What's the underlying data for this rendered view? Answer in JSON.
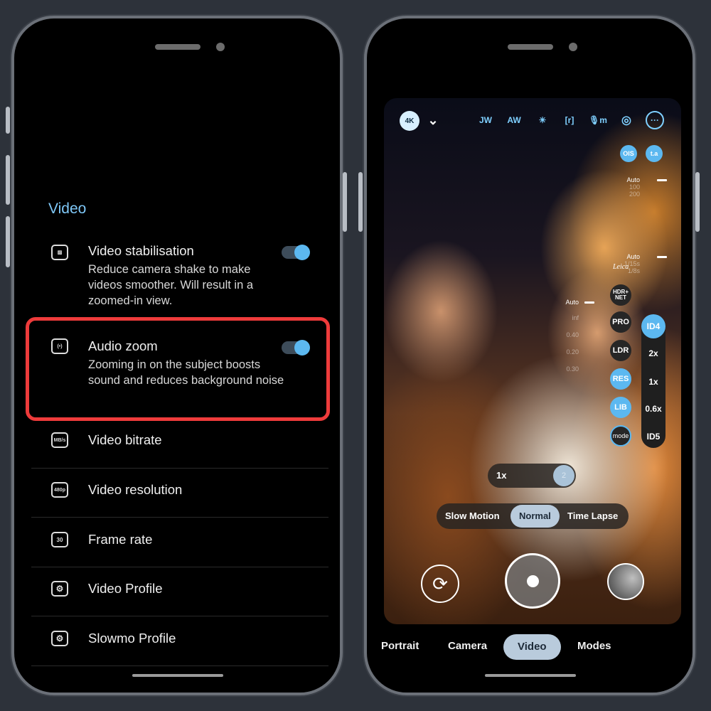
{
  "settings_screen": {
    "section_title": "Video",
    "items": [
      {
        "title": "Video stabilisation",
        "description": "Reduce camera shake to make videos smoother. Will result in a zoomed-in view.",
        "icon": "stabilisation-icon",
        "toggle": true
      },
      {
        "title": "Audio zoom",
        "description": "Zooming in on the subject boosts sound and reduces background noise",
        "icon": "audio-zoom-icon",
        "toggle": true,
        "highlighted": true
      },
      {
        "title": "Video bitrate",
        "icon": "bitrate-icon",
        "icon_text": "MB/s"
      },
      {
        "title": "Video resolution",
        "icon": "resolution-icon",
        "icon_text": "480p"
      },
      {
        "title": "Frame rate",
        "icon": "frame-rate-icon",
        "icon_text": "30"
      },
      {
        "title": "Video Profile",
        "icon": "gear-icon",
        "icon_text": "⚙"
      },
      {
        "title": "Slowmo Profile",
        "icon": "gear-icon",
        "icon_text": "⚙"
      }
    ],
    "accent_color": "#7fc8f8",
    "highlight_color": "#ee3b3b"
  },
  "camera_screen": {
    "top_bar": {
      "resolution_badge": "4K",
      "expand_chevron": "⌄",
      "icons": [
        {
          "name": "white-balance-icon",
          "text": "JW"
        },
        {
          "name": "auto-white-balance-icon",
          "text": "AW"
        },
        {
          "name": "sunrise-icon",
          "text": "☀"
        },
        {
          "name": "frame-icon",
          "text": "[r]"
        },
        {
          "name": "microphone-icon",
          "text": "🎙m"
        },
        {
          "name": "aperture-icon",
          "text": "◎"
        },
        {
          "name": "more-icon",
          "text": "···"
        }
      ]
    },
    "quick_buttons": {
      "ois": "OIS",
      "fps": "t.a"
    },
    "iso_readout": {
      "current": "Auto",
      "values": [
        "100",
        "200"
      ]
    },
    "shutter_readout": {
      "current": "Auto",
      "values": [
        "1/15s",
        "1/8s"
      ]
    },
    "focus_readout": {
      "current": "Auto",
      "values": [
        "inf",
        "0.40",
        "0.20",
        "0.30"
      ]
    },
    "brand_logo": "Leica",
    "side_buttons": [
      {
        "label": "HDR+ NET",
        "active": false
      },
      {
        "label": "PRO",
        "active": false
      },
      {
        "label": "LDR",
        "active": false
      },
      {
        "label": "RES",
        "active": true
      },
      {
        "label": "LIB",
        "active": true
      },
      {
        "label": "mode",
        "active": false
      }
    ],
    "zoom_levels": [
      {
        "label": "ID4",
        "active": true
      },
      {
        "label": "2x",
        "active": false
      },
      {
        "label": "1x",
        "active": false
      },
      {
        "label": "0.6x",
        "active": false
      },
      {
        "label": "ID5",
        "active": false
      }
    ],
    "zoom_slider": {
      "label": "1x",
      "thumb": "2"
    },
    "speed_modes": [
      {
        "label": "Slow Motion",
        "active": false
      },
      {
        "label": "Normal",
        "active": true
      },
      {
        "label": "Time Lapse",
        "active": false
      }
    ],
    "mode_tabs": [
      {
        "label": "Portrait",
        "active": false
      },
      {
        "label": "Camera",
        "active": false
      },
      {
        "label": "Video",
        "active": true
      },
      {
        "label": "Modes",
        "active": false
      }
    ]
  }
}
